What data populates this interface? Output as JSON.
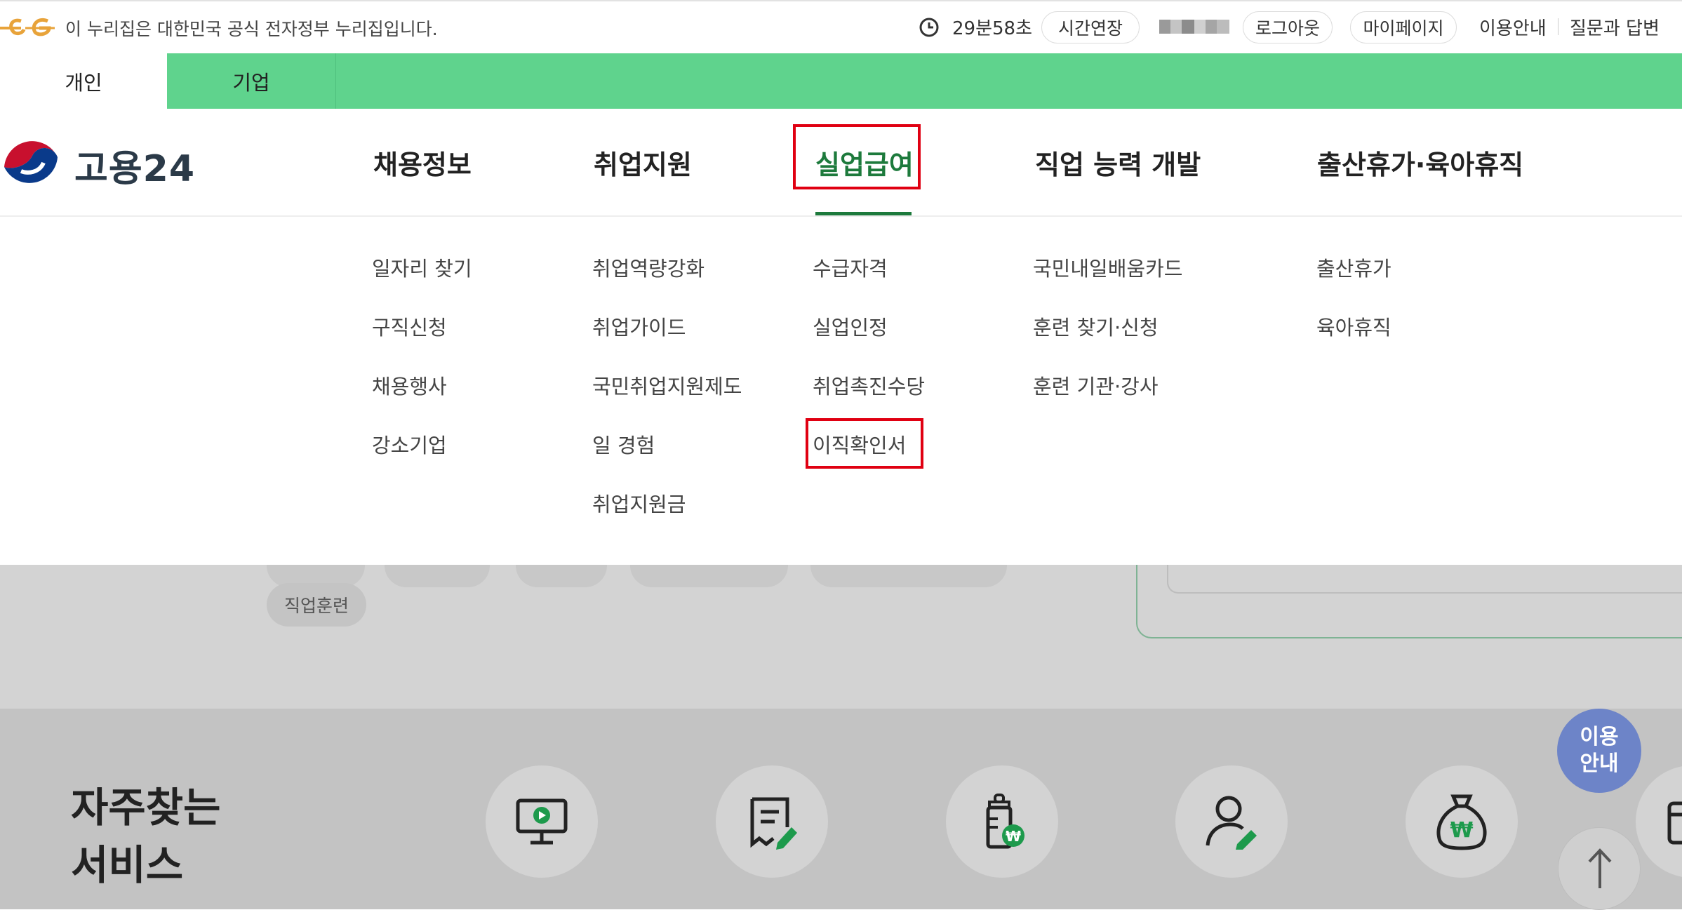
{
  "gov_bar": {
    "notice": "이 누리집은 대한민국 공식 전자정부 누리집입니다.",
    "timer": "29분58초",
    "extend_label": "시간연장",
    "logout_label": "로그아웃",
    "mypage_label": "마이페이지",
    "guide_label": "이용안내",
    "qna_label": "질문과 답변"
  },
  "audience_tabs": [
    {
      "label": "개인",
      "selected": true
    },
    {
      "label": "기업",
      "selected": false
    }
  ],
  "brand": {
    "name": "고용24"
  },
  "gnb": [
    {
      "label": "채용정보"
    },
    {
      "label": "취업지원"
    },
    {
      "label": "실업급여",
      "active": true
    },
    {
      "label": "직업 능력 개발"
    },
    {
      "label": "출산휴가·육아휴직"
    }
  ],
  "submenu": [
    [
      "일자리 찾기",
      "구직신청",
      "채용행사",
      "강소기업"
    ],
    [
      "취업역량강화",
      "취업가이드",
      "국민취업지원제도",
      "일 경험",
      "취업지원금"
    ],
    [
      "수급자격",
      "실업인정",
      "취업촉진수당",
      "이직확인서"
    ],
    [
      "국민내일배움카드",
      "훈련 찾기·신청",
      "훈련 기관·강사"
    ],
    [
      "출산휴가",
      "육아휴직"
    ]
  ],
  "background": {
    "chip_training": "직업훈련",
    "frequent_title": "자주찾는 서비스",
    "help_label": "이용 안내"
  },
  "colors": {
    "tab_green": "#5fd38d",
    "active_green": "#1d7a3c",
    "highlight_red": "#e00012",
    "help_blue": "#6d84c8"
  },
  "icons": [
    "clock-icon",
    "monitor-play-icon",
    "document-edit-icon",
    "baby-bottle-won-icon",
    "user-edit-icon",
    "money-bag-won-icon",
    "arrow-up-icon"
  ]
}
